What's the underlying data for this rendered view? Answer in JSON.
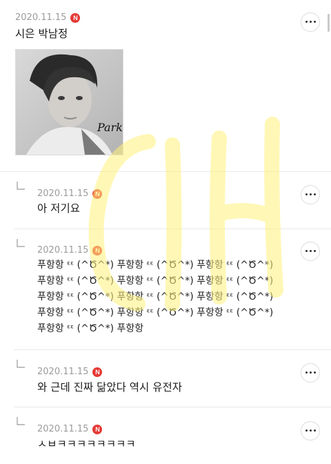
{
  "comments": [
    {
      "date": "2020.11.15",
      "badge": "N",
      "text": "시은 박남정",
      "reply": false
    },
    {
      "date": "2020.11.15",
      "badge": "N",
      "text": "아 저기요",
      "reply": true
    },
    {
      "date": "2020.11.15",
      "badge": "N",
      "reply": true,
      "lines": [
        "푸항항 ᵋ﻿ᵋ (^Ծ^*) 푸항항 ᵋᵋ (^Ծ^*) 푸항항 ᵋᵋ (^Ծ^*)",
        "푸항항 ᵋᵋ (^Ծ^*) 푸항항 ᵋᵋ (^Ծ^*) 푸항항 ᵋᵋ (^Ծ^*)",
        "푸항항 ᵋᵋ (^Ծ^*) 푸항항 ᵋᵋ (^Ծ^*) 푸항항 ᵋᵋ (^Ծ^*)",
        "푸항항 ᵋᵋ (^Ծ^*) 푸항항 ᵋᵋ (^Ծ^*) 푸항항 ᵋᵋ (^Ծ^*)",
        "푸항항 ᵋᵋ (^Ծ^*) 푸항항"
      ]
    },
    {
      "date": "2020.11.15",
      "badge": "N",
      "text": "와 근데 진짜 닮았다 역시 유전자",
      "reply": true
    },
    {
      "date": "2020.11.15",
      "badge": "N",
      "text": "ㅅㅂㅋㅋㅋㅋㅋㅋㅋㅋ",
      "reply": true
    }
  ],
  "photo": {
    "signature": "Park"
  },
  "watermark": {
    "text": "CIH",
    "color": "#fff27a"
  }
}
